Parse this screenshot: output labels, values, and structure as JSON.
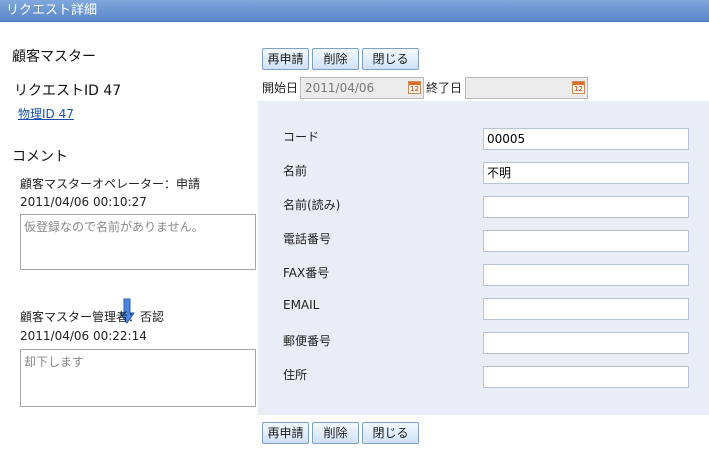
{
  "window": {
    "title": "リクエスト詳細"
  },
  "left": {
    "section_title": "顧客マスター",
    "request_id": "リクエストID 47",
    "physical_id_link": "物理ID 47",
    "comment_heading": "コメント",
    "comments": [
      {
        "author_status": "顧客マスターオペレーター：申請",
        "timestamp": "2011/04/06 00:10:27",
        "text": "仮登録なので名前がありません。"
      },
      {
        "author_status": "顧客マスター管理者：否認",
        "timestamp": "2011/04/06 00:22:14",
        "text": "却下します"
      }
    ],
    "flow_arrow_icon": "arrow-down-icon"
  },
  "toolbar": {
    "resubmit_label": "再申請",
    "delete_label": "削除",
    "close_label": "閉じる"
  },
  "dates": {
    "start_label": "開始日",
    "start_value": "2011/04/06",
    "end_label": "終了日",
    "end_value": "",
    "calendar_icon_text": "12"
  },
  "form": {
    "fields": [
      {
        "label": "コード",
        "value": "00005"
      },
      {
        "label": "名前",
        "value": "不明"
      },
      {
        "label": "名前(読み)",
        "value": ""
      },
      {
        "label": "電話番号",
        "value": ""
      },
      {
        "label": "FAX番号",
        "value": ""
      },
      {
        "label": "EMAIL",
        "value": ""
      },
      {
        "label": "郵便番号",
        "value": ""
      },
      {
        "label": "住所",
        "value": ""
      }
    ]
  },
  "colors": {
    "titlebar": "#6a96d2",
    "panel_bg": "#e9edf6",
    "arrow": "#3d7bd9"
  }
}
